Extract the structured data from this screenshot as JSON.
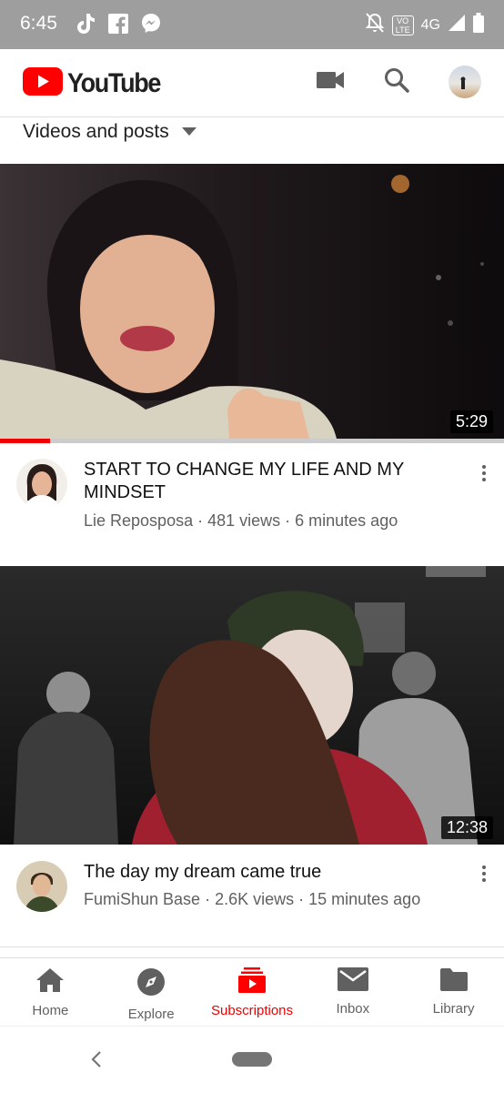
{
  "status_bar": {
    "time": "6:45",
    "network": "4G",
    "volte": "VO LTE"
  },
  "app": {
    "name": "YouTube"
  },
  "filter": {
    "label": "Videos and posts"
  },
  "videos": [
    {
      "title": "START TO CHANGE MY LIFE AND MY MINDSET",
      "channel": "Lie Reposposa",
      "views": "481 views",
      "age": "6 minutes ago",
      "duration": "5:29",
      "watched_fraction": 0.1
    },
    {
      "title": "The day my dream came true",
      "channel": "FumiShun Base",
      "views": "2.6K views",
      "age": "15 minutes ago",
      "duration": "12:38"
    }
  ],
  "separator": " · ",
  "bottom_nav": [
    {
      "label": "Home",
      "icon": "home-icon"
    },
    {
      "label": "Explore",
      "icon": "compass-icon"
    },
    {
      "label": "Subscriptions",
      "icon": "subscriptions-icon",
      "active": true
    },
    {
      "label": "Inbox",
      "icon": "mail-icon"
    },
    {
      "label": "Library",
      "icon": "folder-icon"
    }
  ],
  "colors": {
    "accent": "#ff0000",
    "status_bar": "#9e9e9e",
    "text_secondary": "#606060"
  }
}
